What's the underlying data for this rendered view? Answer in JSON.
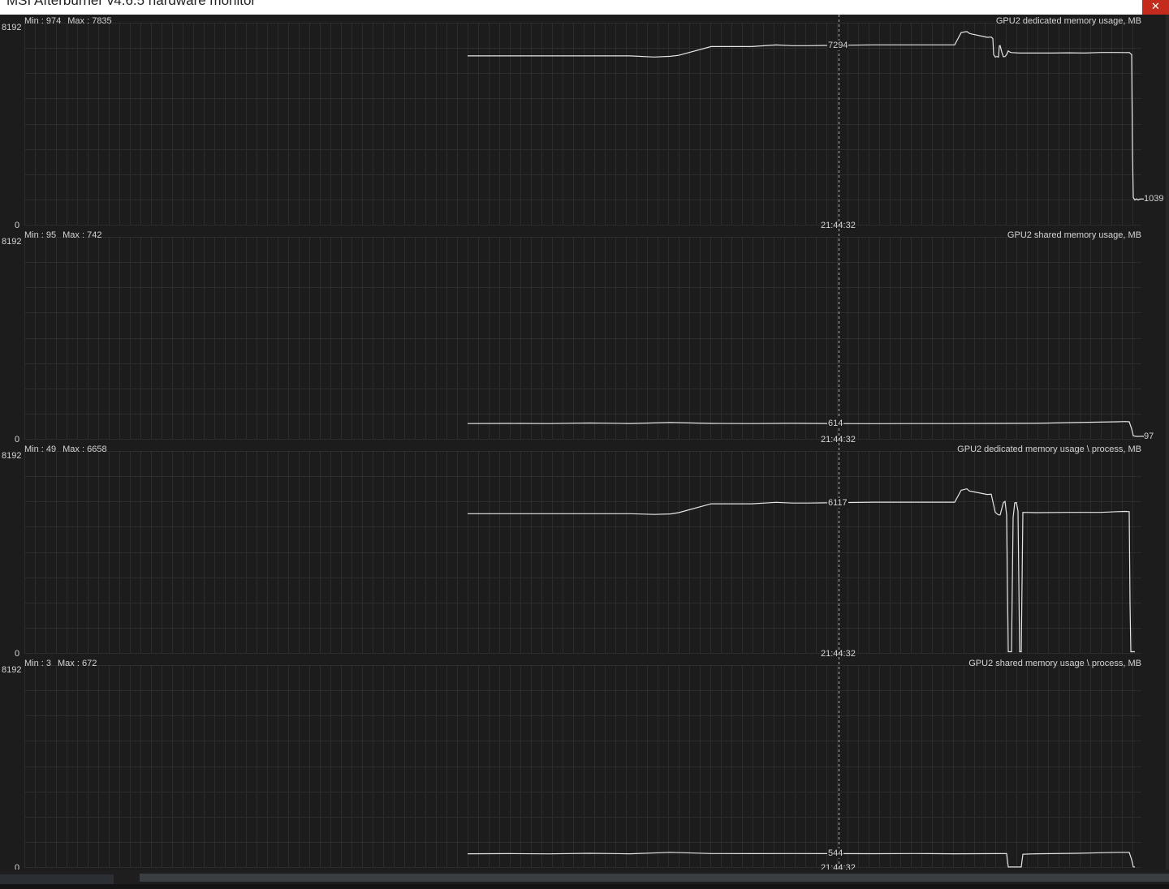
{
  "window": {
    "title": "MSI Afterburner v4.6.5 hardware monitor",
    "close_glyph": "✕"
  },
  "colors": {
    "background": "#1c1c1c",
    "grid": "#2c2c2c",
    "line": "#e6e6e6",
    "cursor": "#bbbbbb",
    "close": "#c42b1c"
  },
  "cursor_time": "21:44:32",
  "chart_data": [
    {
      "type": "line",
      "title": "GPU2 dedicated memory usage, MB",
      "min_label": "Min : 974",
      "max_label": "Max : 7835",
      "ymax_label": "8192",
      "ymin_label": "0",
      "ylim": [
        0,
        8192
      ],
      "cursor_value": "7294",
      "last_value": "1039",
      "series": [
        {
          "x": [
            0,
            200,
            230,
            250,
            260,
            300,
            350,
            380,
            400,
            420,
            500,
            600,
            608,
            615,
            618,
            620,
            640,
            645,
            647,
            648,
            650,
            652,
            654,
            655,
            656,
            658,
            660,
            662,
            664,
            666,
            668,
            670,
            680,
            700,
            720,
            740,
            760,
            780,
            800,
            810,
            815,
            818,
            819,
            820,
            822,
            824,
            826,
            828,
            830,
            833
          ],
          "y": [
            6845,
            6845,
            6800,
            6830,
            6870,
            7224,
            7224,
            7290,
            7260,
            7260,
            7294,
            7294,
            7792,
            7835,
            7760,
            7740,
            7600,
            7610,
            7550,
            6900,
            6800,
            6820,
            6800,
            7250,
            7260,
            7000,
            6810,
            6820,
            6900,
            7050,
            7000,
            6980,
            6960,
            6960,
            6960,
            6970,
            6960,
            6985,
            6985,
            6980,
            6985,
            6900,
            3000,
            1100,
            1000,
            1050,
            1000,
            1040,
            1039,
            1039
          ]
        }
      ]
    },
    {
      "type": "line",
      "title": "GPU2 shared memory usage, MB",
      "min_label": "Min : 95",
      "max_label": "Max : 742",
      "ymax_label": "8192",
      "ymin_label": "0",
      "ylim": [
        0,
        8192
      ],
      "cursor_value": "614",
      "last_value": "97",
      "series": [
        {
          "x": [
            0,
            50,
            100,
            150,
            200,
            250,
            300,
            350,
            400,
            450,
            500,
            550,
            600,
            650,
            700,
            750,
            800,
            810,
            815,
            818,
            820,
            825,
            830,
            833
          ],
          "y": [
            620,
            625,
            618,
            640,
            622,
            660,
            625,
            620,
            628,
            620,
            614,
            618,
            620,
            625,
            630,
            660,
            690,
            700,
            690,
            400,
            120,
            97,
            105,
            97
          ]
        }
      ]
    },
    {
      "type": "line",
      "title": "GPU2 dedicated memory usage \\ process, MB",
      "min_label": "Min : 49",
      "max_label": "Max : 6658",
      "ymax_label": "8192",
      "ymin_label": "0",
      "ylim": [
        0,
        8192
      ],
      "cursor_value": "6117",
      "last_value": "",
      "series": [
        {
          "x": [
            0,
            200,
            230,
            250,
            260,
            300,
            350,
            380,
            400,
            420,
            500,
            600,
            608,
            615,
            618,
            620,
            640,
            645,
            650,
            654,
            656,
            660,
            662,
            664,
            666,
            668,
            670,
            672,
            674,
            676,
            678,
            680,
            682,
            684,
            700,
            740,
            780,
            800,
            810,
            815,
            816,
            817,
            820,
            822
          ],
          "y": [
            5650,
            5650,
            5620,
            5640,
            5690,
            6050,
            6050,
            6110,
            6080,
            6080,
            6117,
            6117,
            6600,
            6658,
            6570,
            6560,
            6430,
            6440,
            5700,
            5600,
            5600,
            6100,
            6150,
            5600,
            49,
            49,
            49,
            5500,
            6090,
            6100,
            5750,
            49,
            49,
            5700,
            5690,
            5700,
            5700,
            5730,
            5740,
            5730,
            2000,
            49,
            49,
            49
          ]
        }
      ]
    },
    {
      "type": "line",
      "title": "GPU2 shared memory usage \\ process, MB",
      "min_label": "Min : 3",
      "max_label": "Max : 672",
      "ymax_label": "8192",
      "ymin_label": "0",
      "ylim": [
        0,
        8192
      ],
      "cursor_value": "544",
      "last_value": "",
      "series": [
        {
          "x": [
            0,
            50,
            100,
            150,
            200,
            250,
            300,
            350,
            400,
            450,
            500,
            550,
            600,
            650,
            664,
            666,
            667,
            680,
            682,
            684,
            700,
            750,
            800,
            815,
            818,
            820,
            822
          ],
          "y": [
            540,
            545,
            535,
            560,
            540,
            600,
            550,
            545,
            550,
            545,
            544,
            548,
            540,
            545,
            548,
            3,
            3,
            3,
            3,
            520,
            540,
            560,
            600,
            600,
            300,
            10,
            3
          ]
        }
      ]
    }
  ]
}
